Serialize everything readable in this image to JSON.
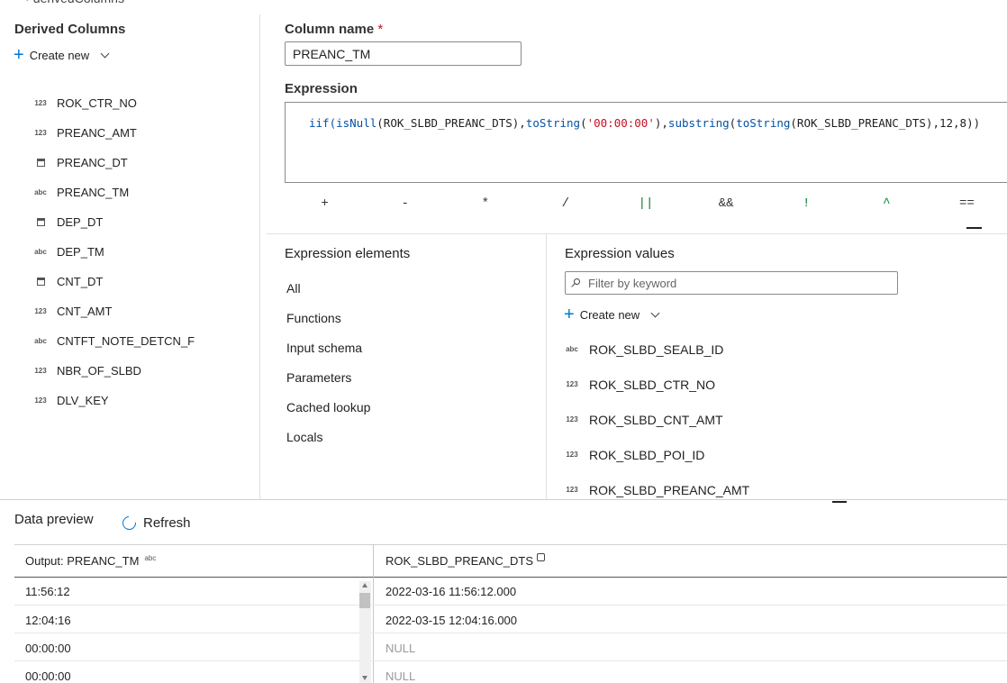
{
  "breadcrumb": "derivedColumns",
  "derived_columns": {
    "title": "Derived Columns",
    "create_new": "Create new",
    "items": [
      {
        "type": "123",
        "label": "ROK_CTR_NO"
      },
      {
        "type": "123",
        "label": "PREANC_AMT"
      },
      {
        "type": "date",
        "label": "PREANC_DT"
      },
      {
        "type": "abc",
        "label": "PREANC_TM"
      },
      {
        "type": "date",
        "label": "DEP_DT"
      },
      {
        "type": "abc",
        "label": "DEP_TM"
      },
      {
        "type": "date",
        "label": "CNT_DT"
      },
      {
        "type": "123",
        "label": "CNT_AMT"
      },
      {
        "type": "abc",
        "label": "CNTFT_NOTE_DETCN_F"
      },
      {
        "type": "123",
        "label": "NBR_OF_SLBD"
      },
      {
        "type": "123",
        "label": "DLV_KEY"
      }
    ]
  },
  "editor": {
    "column_name_label": "Column name",
    "required_mark": "*",
    "column_name_value": "PREANC_TM",
    "expression_label": "Expression",
    "expression": {
      "p1": "iif(",
      "p2": "isNull",
      "p3": "(ROK_SLBD_PREANC_DTS),",
      "p4": "toString",
      "p5": "(",
      "p6": "'00:00:00'",
      "p7": "),",
      "p8": "substring",
      "p9": "(",
      "p10": "toString",
      "p11": "(ROK_SLBD_PREANC_DTS),12,8))"
    },
    "operators": [
      "+",
      "-",
      "*",
      "/",
      "||",
      "&&",
      "!",
      "^",
      "=="
    ]
  },
  "expression_elements": {
    "title": "Expression elements",
    "items": [
      "All",
      "Functions",
      "Input schema",
      "Parameters",
      "Cached lookup",
      "Locals"
    ]
  },
  "expression_values": {
    "title": "Expression values",
    "filter_placeholder": "Filter by keyword",
    "create_new": "Create new",
    "items": [
      {
        "type": "abc",
        "label": "ROK_SLBD_SEALB_ID"
      },
      {
        "type": "123",
        "label": "ROK_SLBD_CTR_NO"
      },
      {
        "type": "123",
        "label": "ROK_SLBD_CNT_AMT"
      },
      {
        "type": "123",
        "label": "ROK_SLBD_POI_ID"
      },
      {
        "type": "123",
        "label": "ROK_SLBD_PREANC_AMT"
      }
    ]
  },
  "data_preview": {
    "title": "Data preview",
    "refresh": "Refresh",
    "columns": [
      {
        "label": "Output: PREANC_TM",
        "type": "abc"
      },
      {
        "label": "ROK_SLBD_PREANC_DTS"
      }
    ],
    "rows": [
      [
        "11:56:12",
        "2022-03-16 11:56:12.000"
      ],
      [
        "12:04:16",
        "2022-03-15 12:04:16.000"
      ],
      [
        "00:00:00",
        "NULL"
      ],
      [
        "00:00:00",
        "NULL"
      ]
    ]
  }
}
